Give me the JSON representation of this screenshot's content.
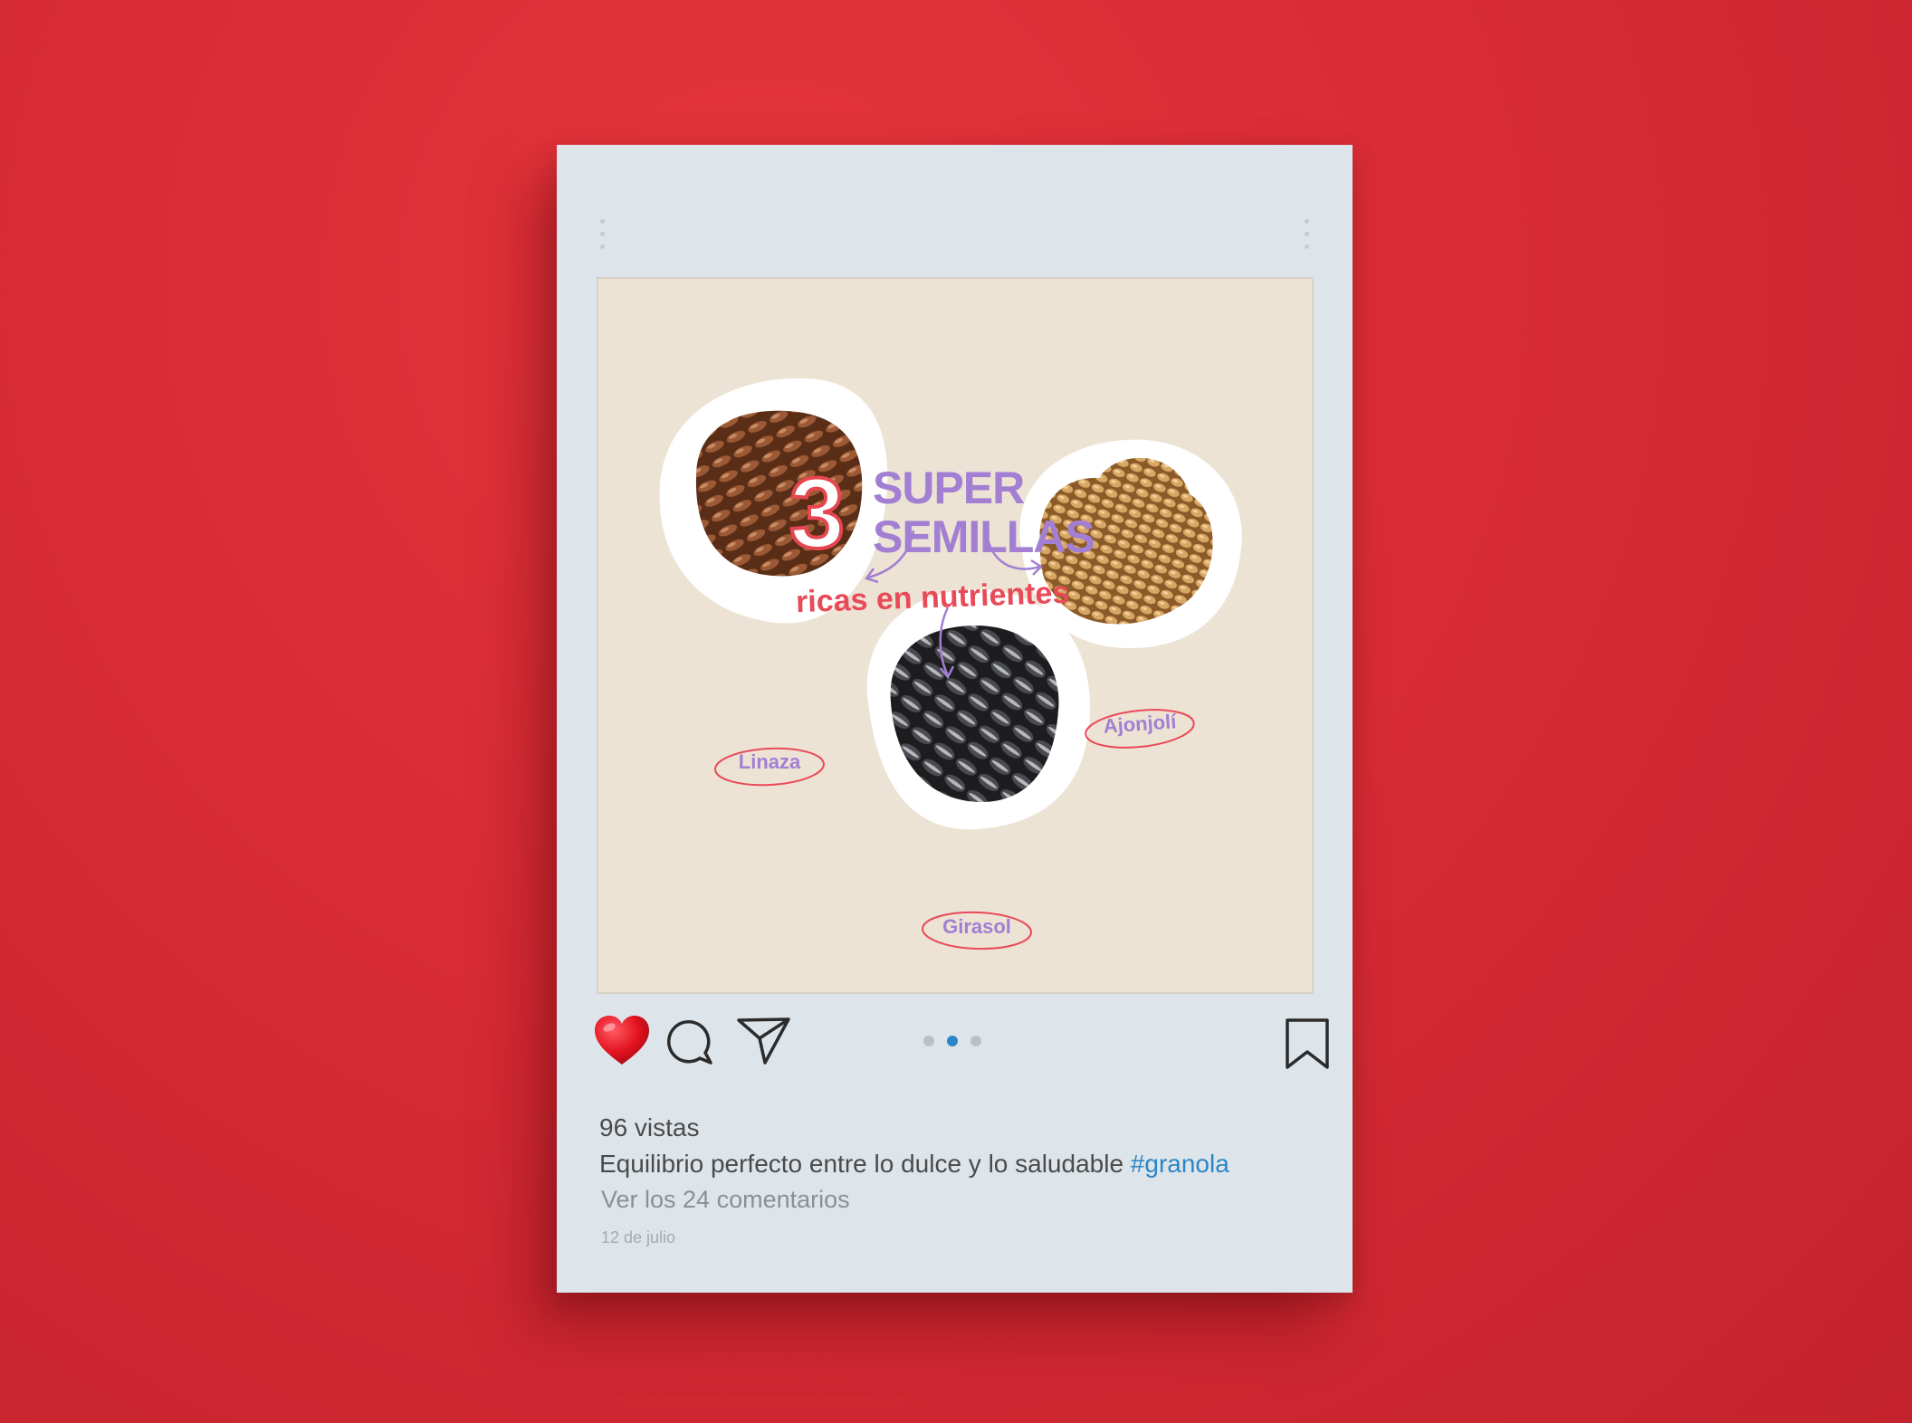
{
  "post": {
    "image": {
      "number": "3",
      "title_line1": "SUPER",
      "title_line2": "SEMILLAS",
      "subtitle": "ricas en nutrientes",
      "seeds": [
        "Linaza",
        "Girasol",
        "Ajonjolí"
      ]
    },
    "actions": {
      "liked": true,
      "carousel_total": 3,
      "carousel_active": 2
    },
    "views": "96 vistas",
    "caption_text": "Equilibrio perfecto entre lo dulce y lo saludable ",
    "hashtag": "#granola",
    "comments_link": "Ver los 24 comentarios",
    "date": "12 de julio"
  },
  "colors": {
    "background": "#d82b35",
    "card": "#dee5ea",
    "image_bg": "#ece3d5",
    "title_purple": "#a27fd2",
    "accent_red": "#e94a58",
    "hashtag": "#2a86c8",
    "active_dot": "#2a86c8"
  }
}
